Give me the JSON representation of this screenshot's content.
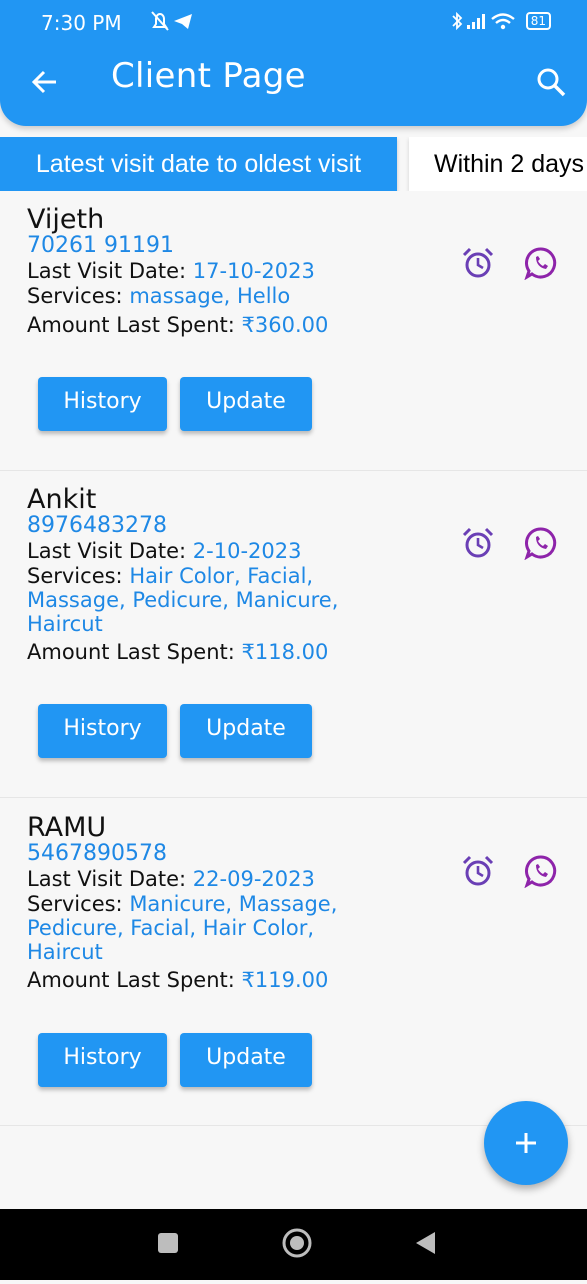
{
  "status_bar": {
    "time": "7:30 PM",
    "battery": "81"
  },
  "app_bar": {
    "title": "Client Page",
    "back_icon": "arrow-left-icon",
    "search_icon": "search-icon"
  },
  "filters": {
    "tabs": [
      {
        "label": "Latest visit date to oldest visit",
        "selected": true
      },
      {
        "label": "Within 2 days",
        "selected": false
      }
    ]
  },
  "labels": {
    "last_visit": "Last Visit Date: ",
    "services": "Services: ",
    "amount": "Amount Last Spent: "
  },
  "clients": [
    {
      "name": "Vijeth",
      "phone": "70261 91191",
      "last_visit_date": "17-10-2023",
      "services": "massage, Hello",
      "amount": "₹360.00",
      "history_label": "History",
      "update_label": "Update"
    },
    {
      "name": "Ankit",
      "phone": "8976483278",
      "last_visit_date": "2-10-2023",
      "services": "Hair Color, Facial, Massage, Pedicure, Manicure, Haircut",
      "amount": "₹118.00",
      "history_label": "History",
      "update_label": "Update"
    },
    {
      "name": "RAMU",
      "phone": "5467890578",
      "last_visit_date": "22-09-2023",
      "services": "Manicure, Massage, Pedicure, Facial, Hair Color, Haircut",
      "amount": "₹119.00",
      "history_label": "History",
      "update_label": "Update"
    }
  ],
  "colors": {
    "primary": "#2196f3",
    "accent_text": "#1e88e5",
    "icon_purple": "#6a3fb5",
    "whatsapp_purple": "#8e24aa"
  }
}
